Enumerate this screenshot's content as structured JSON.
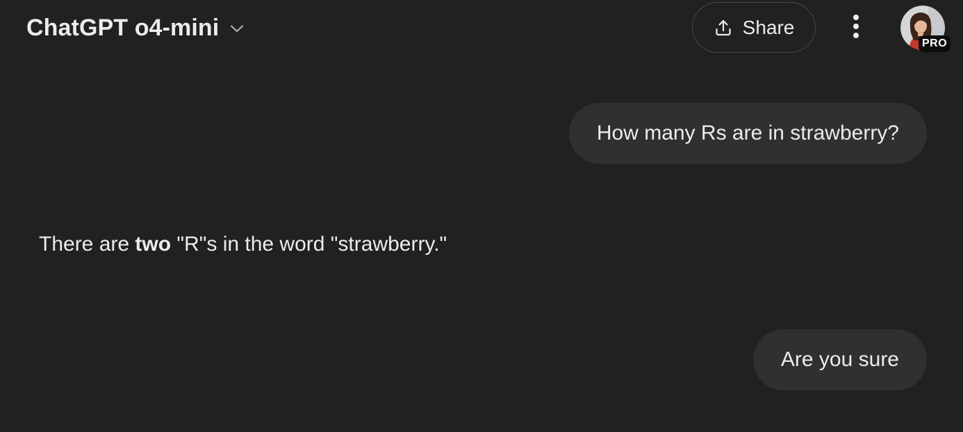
{
  "header": {
    "model_name": "ChatGPT o4-mini",
    "model_chevron_icon": "chevron-down-icon",
    "share_label": "Share",
    "share_icon": "upload-icon",
    "more_icon": "vertical-ellipsis-icon",
    "avatar_badge": "PRO"
  },
  "conversation": {
    "messages": [
      {
        "role": "user",
        "text": "How many Rs are in strawberry?"
      },
      {
        "role": "assistant",
        "text_before": "There are ",
        "text_bold": "two",
        "text_after": " \"R\"s in the word \"strawberry.\""
      },
      {
        "role": "user",
        "text": "Are you sure"
      }
    ]
  },
  "colors": {
    "background": "#212121",
    "user_bubble": "#303030",
    "text": "#ececec",
    "share_border": "#4a4a4a",
    "badge_background": "#0d0d0d"
  }
}
